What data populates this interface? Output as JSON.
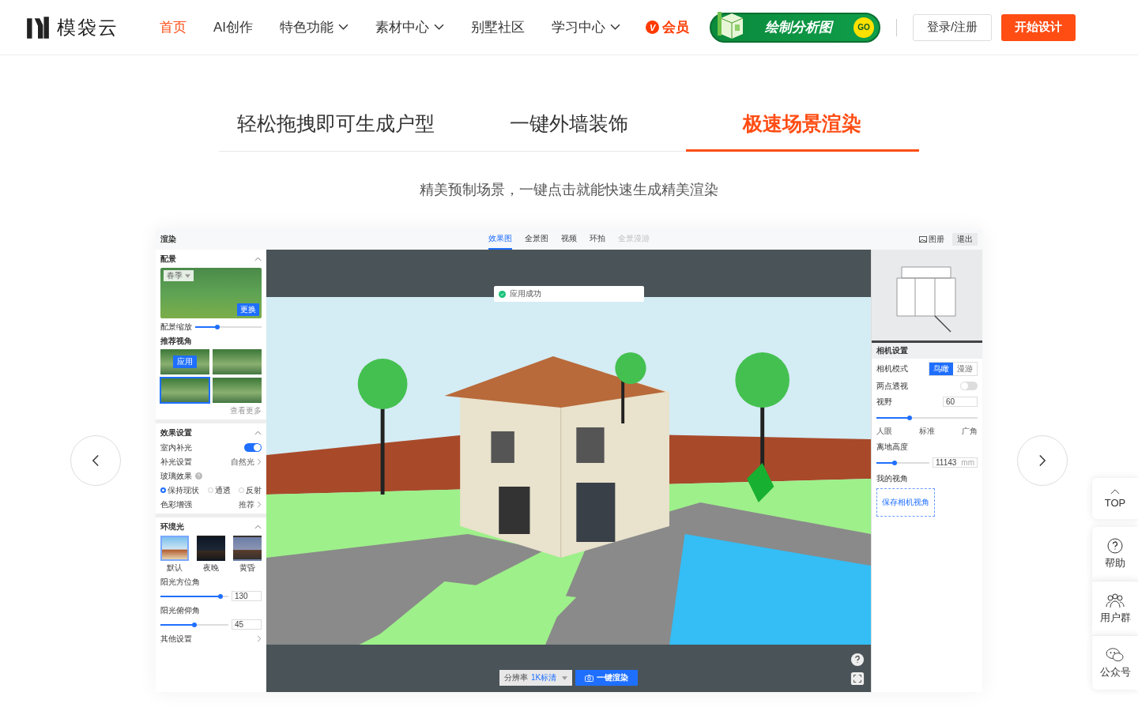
{
  "header": {
    "logo": "模袋云",
    "nav": [
      {
        "label": "首页",
        "selected": true,
        "dropdown": false
      },
      {
        "label": "AI创作",
        "selected": false,
        "dropdown": false
      },
      {
        "label": "特色功能",
        "selected": false,
        "dropdown": true
      },
      {
        "label": "素材中心",
        "selected": false,
        "dropdown": true
      },
      {
        "label": "别墅社区",
        "selected": false,
        "dropdown": false
      },
      {
        "label": "学习中心",
        "selected": false,
        "dropdown": true
      }
    ],
    "member": {
      "badge": "V",
      "label": "会员"
    },
    "promo": {
      "label": "绘制分析图",
      "go": "GO"
    },
    "login": "登录/注册",
    "start": "开始设计"
  },
  "feature_tabs": [
    {
      "label": "轻松拖拽即可生成户型",
      "selected": false
    },
    {
      "label": "一键外墙装饰",
      "selected": false
    },
    {
      "label": "极速场景渲染",
      "selected": true
    }
  ],
  "subtitle": "精美预制场景，一键点击就能快速生成精美渲染",
  "app": {
    "title": "渲染",
    "tabs": [
      {
        "label": "效果图",
        "selected": true,
        "disabled": false
      },
      {
        "label": "全景图",
        "selected": false,
        "disabled": false
      },
      {
        "label": "视频",
        "selected": false,
        "disabled": false
      },
      {
        "label": "环拍",
        "selected": false,
        "disabled": false
      },
      {
        "label": "全景漫游",
        "selected": false,
        "disabled": true
      }
    ],
    "album": "图册",
    "exit": "退出",
    "scenery": {
      "title": "配景",
      "season": "春季",
      "change": "更换",
      "scale_label": "配景缩放",
      "scale": {
        "level": 0.33
      },
      "views_title": "推荐视角",
      "views": [
        {
          "selected": false,
          "apply": "应用"
        },
        {
          "selected": false
        },
        {
          "selected": true
        },
        {
          "selected": false
        }
      ],
      "more": "查看更多"
    },
    "effects": {
      "title": "效果设置",
      "rows": [
        {
          "kind": "toggle",
          "label": "室内补光",
          "on": true
        },
        {
          "kind": "link",
          "label": "补光设置",
          "value": "自然光"
        },
        {
          "kind": "radio",
          "label": "玻璃效果",
          "options": [
            {
              "label": "保持现状",
              "selected": true
            },
            {
              "label": "通透",
              "selected": false
            },
            {
              "label": "反射",
              "selected": false
            }
          ]
        },
        {
          "kind": "link",
          "label": "色彩增强",
          "value": "推荐"
        }
      ]
    },
    "ambient": {
      "title": "环境光",
      "presets": [
        {
          "label": "默认",
          "selected": true,
          "kind": "day"
        },
        {
          "label": "夜晚",
          "selected": false,
          "kind": "night"
        },
        {
          "label": "黄昏",
          "selected": false,
          "kind": "dusk"
        }
      ],
      "sliders": [
        {
          "label": "阳光方位角",
          "level": 0.88,
          "value": "130"
        },
        {
          "label": "阳光俯仰角",
          "level": 0.5,
          "value": "45"
        }
      ],
      "other": "其他设置"
    },
    "viewport": {
      "toast": "应用成功",
      "resolution_label": "分辨率",
      "resolution": "1K标清",
      "render": "一键渲染"
    },
    "camera": {
      "title": "相机设置",
      "mode_label": "相机模式",
      "modes": [
        {
          "label": "鸟瞰",
          "selected": true
        },
        {
          "label": "漫游",
          "selected": false
        }
      ],
      "perspective": {
        "label": "两点透视",
        "on": false
      },
      "fov": {
        "label": "视野",
        "value": "60",
        "level": 0.33,
        "ticks": [
          "人眼",
          "标准",
          "广角"
        ]
      },
      "height": {
        "label": "离地高度",
        "level": 0.35,
        "value": "11143",
        "unit": "mm"
      },
      "my_views": "我的视角",
      "save": "保存相机视角"
    }
  },
  "float_bar": [
    {
      "kind": "top",
      "label": "TOP"
    },
    {
      "kind": "help",
      "label": "帮助"
    },
    {
      "kind": "group",
      "label": "用户群"
    },
    {
      "kind": "wechat",
      "label": "公众号"
    }
  ]
}
